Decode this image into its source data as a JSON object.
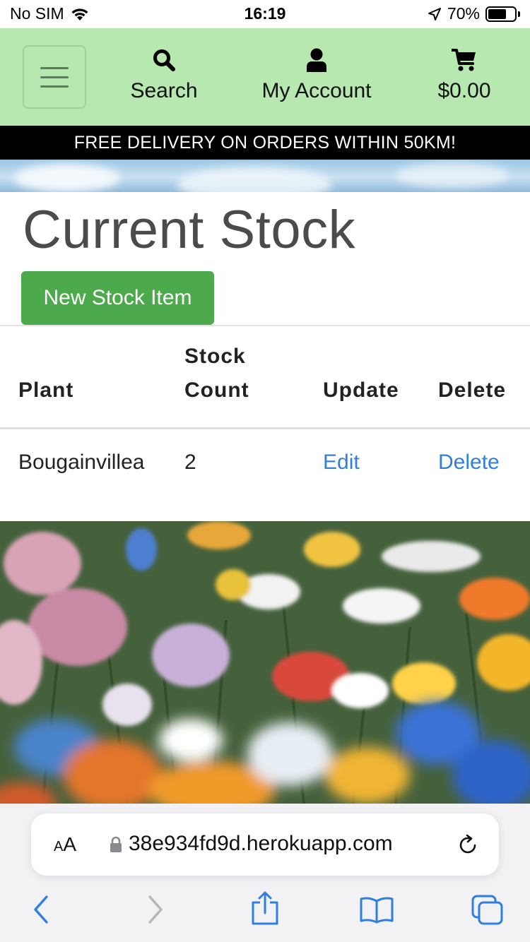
{
  "status_bar": {
    "carrier": "No SIM",
    "time": "16:19",
    "battery_percent": "70%",
    "battery_level": 0.7
  },
  "header": {
    "menu_toggle_icon": "hamburger-icon",
    "nav": [
      {
        "icon": "search-icon",
        "label": "Search"
      },
      {
        "icon": "user-icon",
        "label": "My Account"
      },
      {
        "icon": "cart-icon",
        "label": "$0.00"
      }
    ],
    "color": "#b6e8b0"
  },
  "banner": {
    "text": "FREE DELIVERY ON ORDERS WITHIN 50KM!"
  },
  "page": {
    "title": "Current Stock",
    "new_button": "New Stock Item"
  },
  "table": {
    "headers": {
      "plant": "Plant",
      "stock_line1": "Stock",
      "stock_line2": "Count",
      "update": "Update",
      "delete": "Delete"
    },
    "rows": [
      {
        "plant": "Bougainvillea",
        "count": "2",
        "edit": "Edit",
        "delete": "Delete"
      }
    ]
  },
  "browser": {
    "aa_big": "A",
    "aa_small": "A",
    "url": "38e934fd9d.herokuapp.com",
    "accent_color": "#2f7fe0"
  }
}
